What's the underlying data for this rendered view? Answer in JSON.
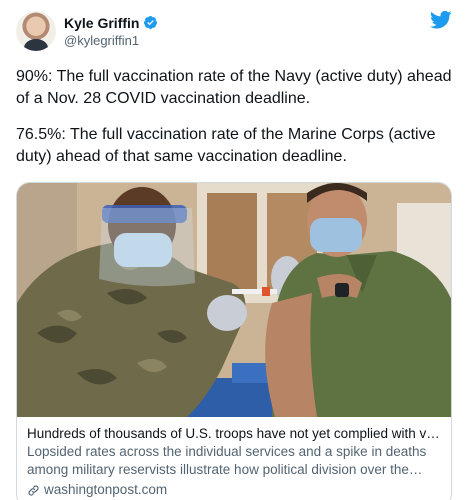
{
  "author": {
    "display_name": "Kyle Griffin",
    "handle": "@kylegriffin1",
    "verified": true
  },
  "tweet": {
    "paragraphs": [
      "90%: The full vaccination rate of the Navy (active duty) ahead of a Nov. 28 COVID vaccination deadline.",
      "76.5%: The full vaccination rate of the Marine Corps (active duty) ahead of that same vaccination deadline."
    ]
  },
  "card": {
    "title": "Hundreds of thousands of U.S. troops have not yet complied with vaccine mandate",
    "description": "Lopsided rates across the individual services and a spike in deaths among military reservists illustrate how political division over the shots has ...",
    "domain": "washingtonpost.com"
  },
  "colors": {
    "twitter_blue": "#1d9bf0",
    "text": "#0f1419",
    "secondary": "#536471",
    "border": "#cfd9de"
  },
  "icons": {
    "logo": "twitter-bird-icon",
    "verified": "verified-badge-icon",
    "link": "link-icon"
  }
}
